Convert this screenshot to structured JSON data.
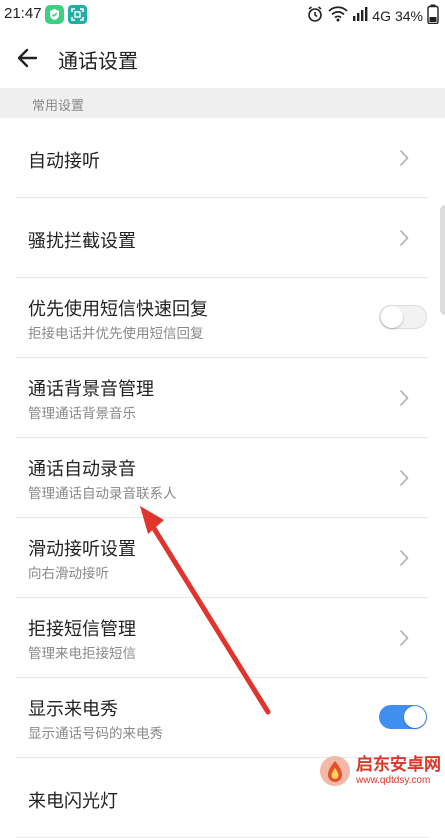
{
  "status_bar": {
    "time": "21:47",
    "network": "4G",
    "battery": "34%"
  },
  "header": {
    "title": "通话设置"
  },
  "section": {
    "label": "常用设置"
  },
  "settings": [
    {
      "title": "自动接听",
      "subtitle": "",
      "control": "chevron"
    },
    {
      "title": "骚扰拦截设置",
      "subtitle": "",
      "control": "chevron"
    },
    {
      "title": "优先使用短信快速回复",
      "subtitle": "拒接电话并优先使用短信回复",
      "control": "toggle",
      "toggle_on": false
    },
    {
      "title": "通话背景音管理",
      "subtitle": "管理通话背景音乐",
      "control": "chevron"
    },
    {
      "title": "通话自动录音",
      "subtitle": "管理通话自动录音联系人",
      "control": "chevron"
    },
    {
      "title": "滑动接听设置",
      "subtitle": "向右滑动接听",
      "control": "chevron"
    },
    {
      "title": "拒接短信管理",
      "subtitle": "管理来电拒接短信",
      "control": "chevron"
    },
    {
      "title": "显示来电秀",
      "subtitle": "显示通话号码的来电秀",
      "control": "toggle",
      "toggle_on": true
    },
    {
      "title": "来电闪光灯",
      "subtitle": "",
      "control": "chevron"
    }
  ],
  "watermark": {
    "name": "启东安卓网",
    "url": "www.qdtdsy.com"
  },
  "colors": {
    "toggle_on": "#3f8ef0",
    "annotation_arrow": "#e0342c",
    "section_bg": "#efefef"
  }
}
